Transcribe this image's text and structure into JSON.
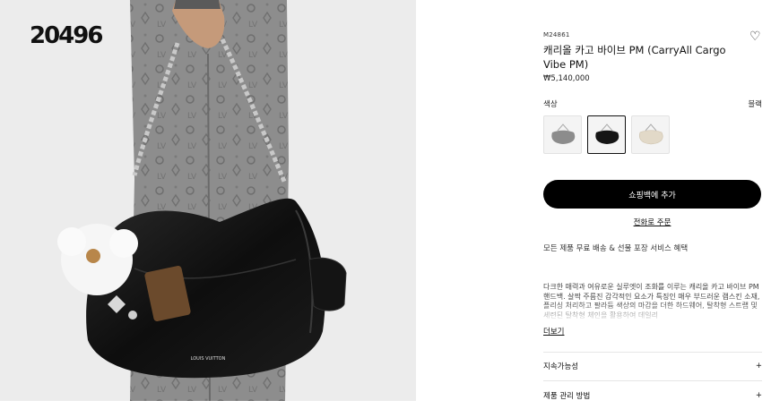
{
  "watermark": "20496",
  "product": {
    "sku": "M24861",
    "title": "캐리올 카고 바이브 PM (CarryAll Cargo Vibe PM)",
    "price": "₩5,140,000",
    "favorite_icon": "heart-icon"
  },
  "color": {
    "label": "색상",
    "selected": "블랙",
    "swatches": [
      {
        "name": "grey",
        "hex": "#8c8c8c"
      },
      {
        "name": "black",
        "hex": "#151515"
      },
      {
        "name": "cream",
        "hex": "#e2d9c8"
      }
    ]
  },
  "actions": {
    "add_to_cart": "쇼핑백에 추가",
    "phone_order": "전화로 주문"
  },
  "benefits": "모든 제품 무료 배송 & 선물 포장 서비스 혜택",
  "description": {
    "text": "다크한 매력과 여유로운 실루엣이 조화를 이루는 캐리올 카고 바이브 PM 핸드백. 살짝 주름진 감각적인 요소가 특징인 매우 부드러운 램스킨 소재, 플리싱 처리하고 팔라듐 색상의 마감을 더한 하드웨어, 탈착형 스트랩 및 세련된 탈착형 체인을 활용하여 데일리",
    "more": "더보기"
  },
  "accordion": [
    {
      "label": "지속가능성",
      "icon": "plus-icon",
      "symbol": "+"
    },
    {
      "label": "제품 관리 방법",
      "icon": "plus-icon",
      "symbol": "+"
    }
  ]
}
